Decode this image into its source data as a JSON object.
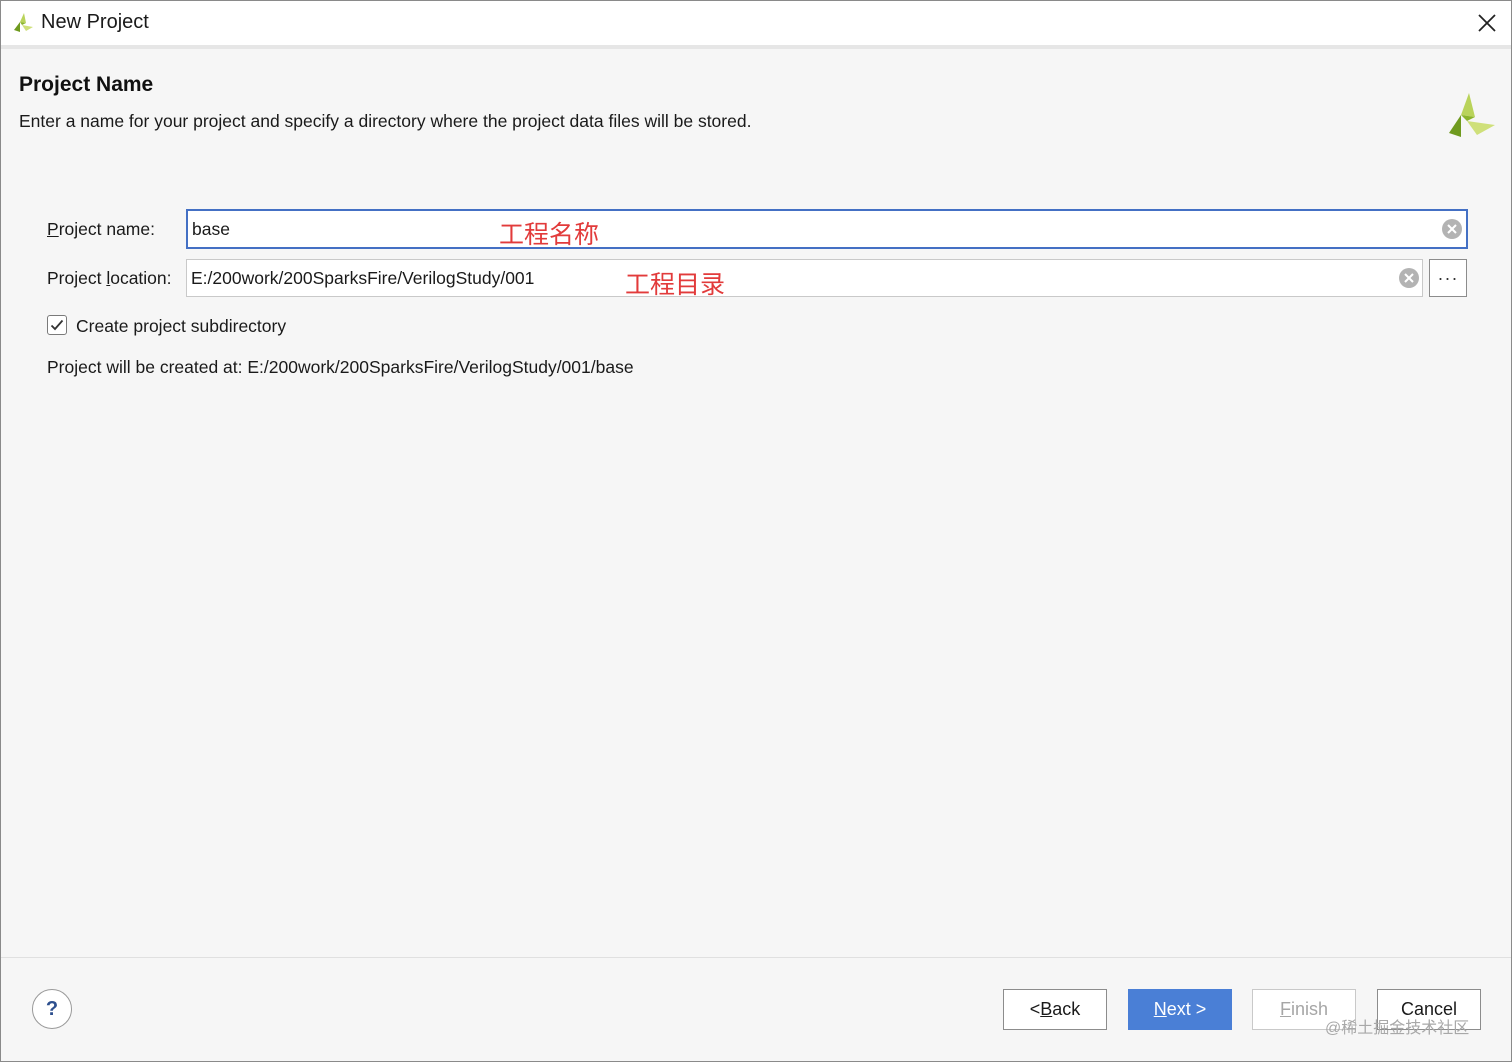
{
  "window": {
    "title": "New Project",
    "close_icon": "close-icon",
    "app_icon": "vivado-logo-icon"
  },
  "header": {
    "title": "Project Name",
    "description": "Enter a name for your project and specify a directory where the project data files will be stored."
  },
  "form": {
    "name_label_mnemonic": "P",
    "name_label_rest": "roject name:",
    "name_value": "base",
    "name_annotation": "工程名称",
    "location_label_pre": "Project ",
    "location_label_mnemonic": "l",
    "location_label_rest": "ocation:",
    "location_value": "E:/200work/200SparksFire/VerilogStudy/001",
    "location_annotation": "工程目录",
    "browse_label": "···",
    "subdir_checked": true,
    "subdir_label": "Create project subdirectory",
    "created_at_text": "Project will be created at: E:/200work/200SparksFire/VerilogStudy/001/base"
  },
  "footer": {
    "help_label": "?",
    "back_pre": "< ",
    "back_mnemonic": "B",
    "back_rest": "ack",
    "next_mnemonic": "N",
    "next_rest": "ext >",
    "finish_mnemonic": "F",
    "finish_rest": "inish",
    "cancel_label": "Cancel",
    "watermark": "@稀土掘金技术社区"
  },
  "colors": {
    "accent": "#4a7fd6",
    "focus_border": "#4470c4",
    "annotation_red": "#e23b3b",
    "logo_green": "#8bb42a"
  }
}
